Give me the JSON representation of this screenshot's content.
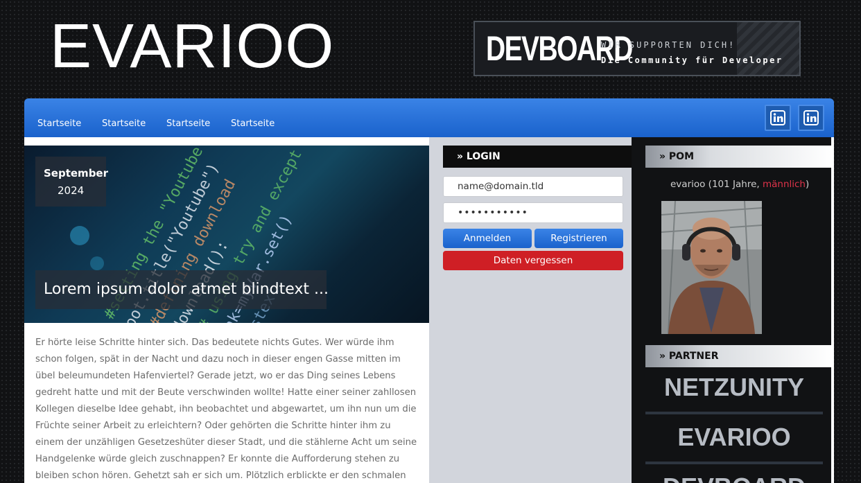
{
  "header": {
    "site_title": "EVARIOO",
    "banner": {
      "logo": "DEVBOARD",
      "tagline_1": "WIR SUPPORTEN DICH!",
      "tagline_2": "Die Community für Developer"
    }
  },
  "nav": {
    "items": [
      {
        "label": "Startseite"
      },
      {
        "label": "Startseite"
      },
      {
        "label": "Startseite"
      },
      {
        "label": "Startseite"
      }
    ],
    "social": [
      {
        "icon": "linkedin-icon"
      },
      {
        "icon": "linkedin-icon"
      }
    ]
  },
  "post": {
    "month": "September",
    "year": "2024",
    "title": "Lorem ipsum dolor atmet blindtext ...",
    "body": "Er hörte leise Schritte hinter sich. Das bedeutete nichts Gutes. Wer würde ihm schon folgen, spät in der Nacht und dazu noch in dieser engen Gasse mitten im übel beleumundeten Hafenviertel? Gerade jetzt, wo er das Ding seines Lebens gedreht hatte und mit der Beute verschwinden wollte! Hatte einer seiner zahllosen Kollegen dieselbe Idee gehabt, ihn beobachtet und abgewartet, um ihn nun um die Früchte seiner Arbeit zu erleichtern? Oder gehörten die Schritte hinter ihm zu einem der unzähligen Gesetzeshüter dieser Stadt, und die stählerne Acht um seine Handgelenke würde gleich zuschnappen? Er konnte die Aufforderung stehen zu bleiben schon hören. Gehetzt sah er sich um. Plötzlich erblickte er den schmalen Durchgang. Blitzartig drehte er sich nach"
  },
  "login": {
    "heading": "» LOGIN",
    "email_value": "name@domain.tld",
    "password_value": "•••••••••••",
    "login_button": "Anmelden",
    "register_button": "Registrieren",
    "forgot_button": "Daten vergessen"
  },
  "pom": {
    "heading": "» POM",
    "user_prefix": "evarioo (101 Jahre, ",
    "gender": "männlich",
    "user_suffix": ")"
  },
  "partner": {
    "heading": "» PARTNER",
    "items": [
      "NETZUNITY",
      "EVARIOO",
      "DEVBOARD"
    ]
  },
  "colors": {
    "accent_blue": "#1a62cc",
    "danger_red": "#cf1f25",
    "background": "#111214"
  }
}
